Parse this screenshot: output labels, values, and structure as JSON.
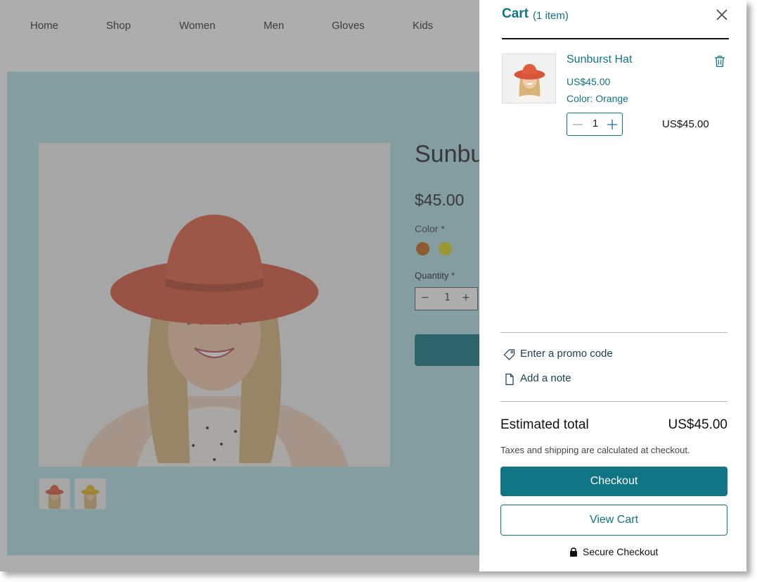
{
  "nav": {
    "items": [
      "Home",
      "Shop",
      "Women",
      "Men",
      "Gloves",
      "Kids"
    ]
  },
  "product": {
    "title": "Sunburst Hat",
    "price": "$45.00",
    "color_label": "Color *",
    "color_options": [
      {
        "name": "Orange",
        "hex": "#c46514"
      },
      {
        "name": "Yellow",
        "hex": "#d9d81c"
      }
    ],
    "quantity_label": "Quantity *",
    "quantity": "1",
    "thumbnails": [
      "orange-hat",
      "yellow-hat"
    ]
  },
  "cart": {
    "title": "Cart",
    "count": "(1 item)",
    "items": [
      {
        "name": "Sunburst Hat",
        "price": "US$45.00",
        "color": "Color: Orange",
        "quantity": "1",
        "line_total": "US$45.00"
      }
    ],
    "promo_link": "Enter a promo code",
    "note_link": "Add a note",
    "estimated_total_label": "Estimated total",
    "estimated_total": "US$45.00",
    "tax_note": "Taxes and shipping are calculated at checkout.",
    "checkout_label": "Checkout",
    "view_cart_label": "View Cart",
    "secure_label": "Secure Checkout"
  },
  "colors": {
    "accent": "#0f7584",
    "hero_background": "#b2e0e8",
    "overlay": "rgba(80,80,80,0.47)"
  }
}
